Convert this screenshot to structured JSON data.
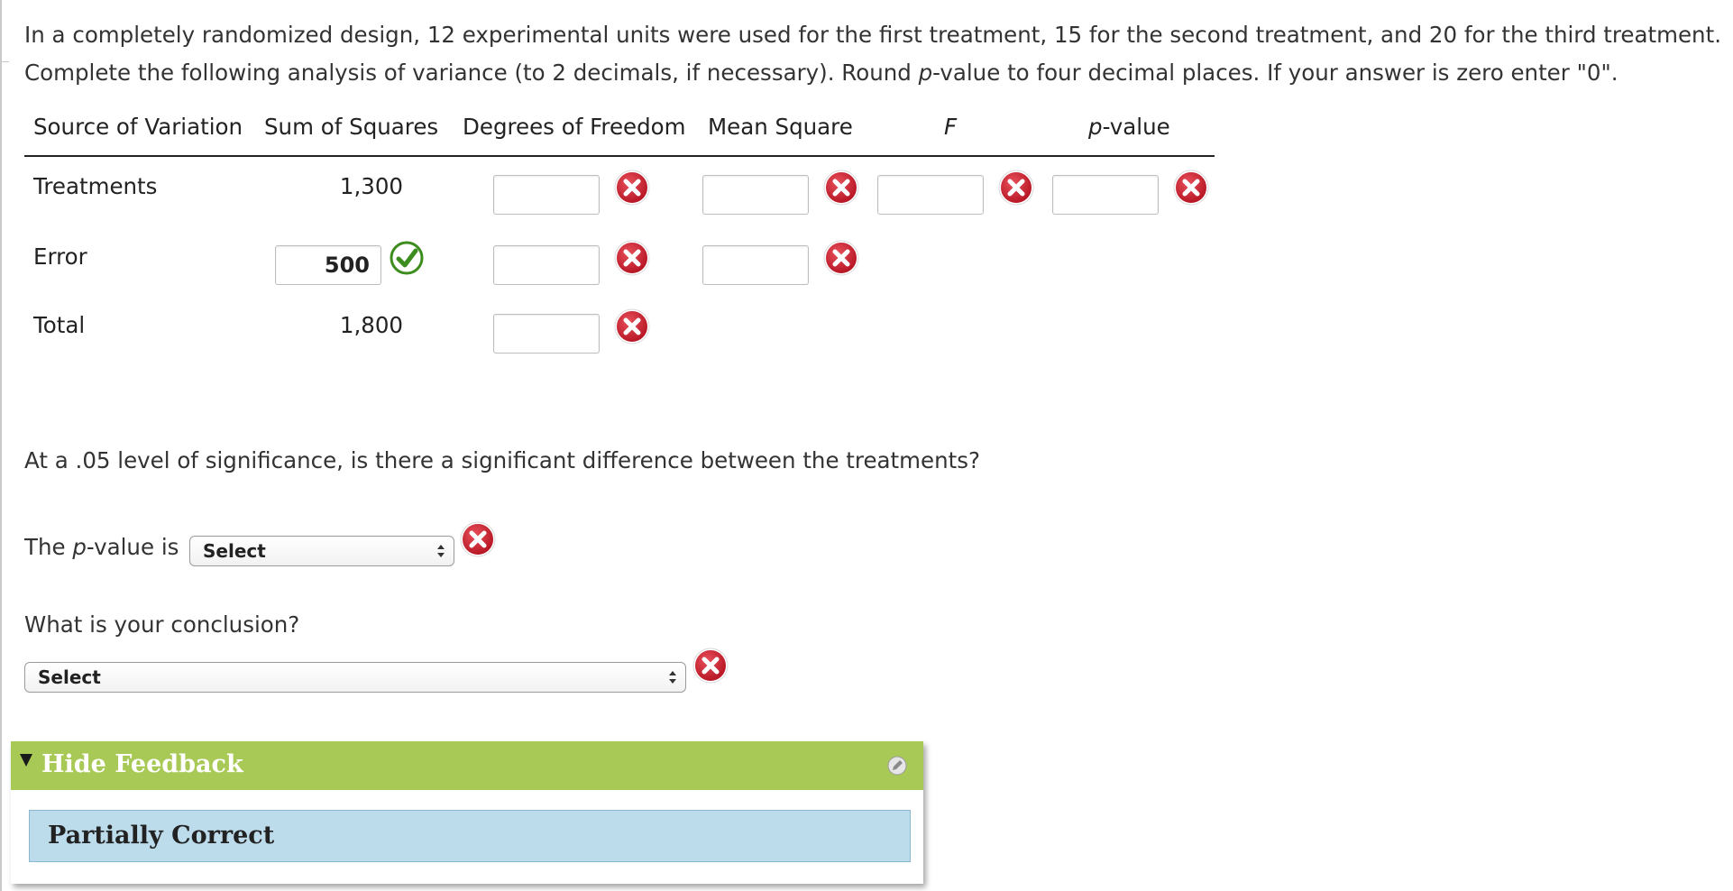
{
  "intro": {
    "line1": "In a completely randomized design, 12 experimental units were used for the first treatment, 15 for the second treatment, and 20 for the third treatment.",
    "line2_pre": "Complete the following analysis of variance (to 2 decimals, if necessary). Round ",
    "line2_p": "p",
    "line2_post": "-value to four decimal places. If your answer is zero enter \"0\"."
  },
  "table": {
    "headers": {
      "source": "Source of Variation",
      "ss": "Sum of Squares",
      "df": "Degrees of Freedom",
      "ms": "Mean Square",
      "f": "F",
      "p_italic": "p",
      "p_rest": "-value"
    },
    "rows": [
      {
        "label": "Treatments",
        "ss": "1,300",
        "df": "",
        "ms": "",
        "f": "",
        "p": ""
      },
      {
        "label": "Error",
        "ss": "500",
        "df": "",
        "ms": ""
      },
      {
        "label": "Total",
        "ss": "1,800",
        "df": ""
      }
    ]
  },
  "question": "At a .05 level of significance, is there a significant difference between the treatments?",
  "pvalue_q": {
    "pre": "The ",
    "p": "p",
    "post": "-value is",
    "select": "Select"
  },
  "conclusion": {
    "question": "What is your conclusion?",
    "select": "Select"
  },
  "feedback": {
    "toggle_label": "Hide Feedback",
    "status": "Partially Correct"
  },
  "colors": {
    "feedback_header": "#a9c957",
    "feedback_body": "#bcdcec",
    "incorrect": "#c8102e",
    "correct": "#3c8d1e"
  },
  "icons": {
    "incorrect": "close-circle-icon",
    "correct": "check-circle-icon",
    "toggle": "triangle-down-icon",
    "edit": "pencil-icon"
  }
}
